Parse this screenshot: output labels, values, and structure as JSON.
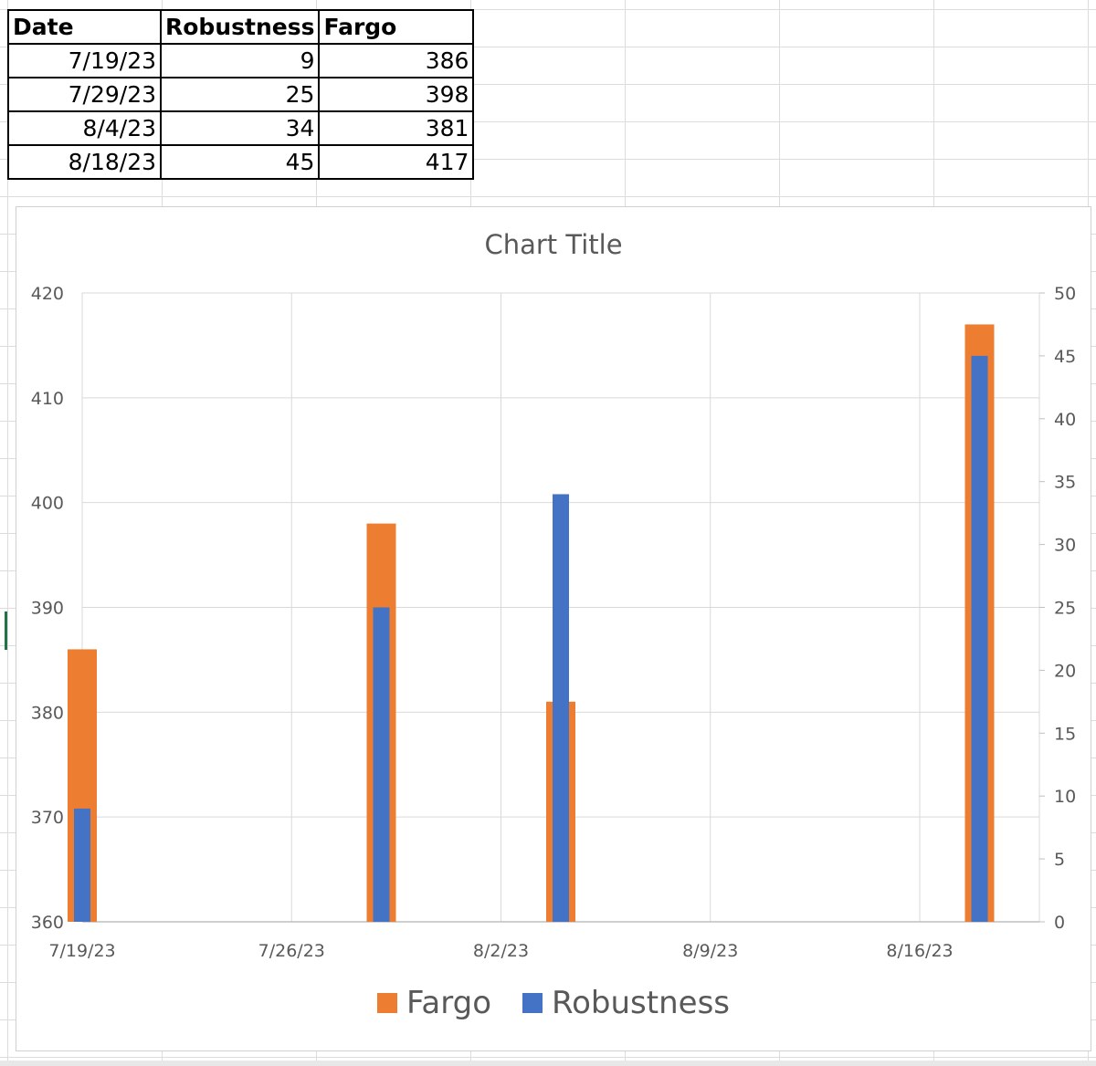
{
  "table": {
    "headers": [
      "Date",
      "Robustness",
      "Fargo"
    ],
    "rows": [
      [
        "7/19/23",
        "9",
        "386"
      ],
      [
        "7/29/23",
        "25",
        "398"
      ],
      [
        "8/4/23",
        "34",
        "381"
      ],
      [
        "8/18/23",
        "45",
        "417"
      ]
    ]
  },
  "chart_data": {
    "type": "bar",
    "title": "Chart Title",
    "x": [
      "7/19/23",
      "7/29/23",
      "8/4/23",
      "8/18/23"
    ],
    "x_axis": {
      "range": [
        "7/19/23",
        "8/20/23"
      ],
      "tick_labels": [
        "7/19/23",
        "7/26/23",
        "8/2/23",
        "8/9/23",
        "8/16/23"
      ]
    },
    "series": [
      {
        "name": "Fargo",
        "axis": "primary",
        "values": [
          386,
          398,
          381,
          417
        ],
        "color": "#ED7D31"
      },
      {
        "name": "Robustness",
        "axis": "secondary",
        "values": [
          9,
          25,
          34,
          45
        ],
        "color": "#4472C4"
      }
    ],
    "y_primary": {
      "ylim": [
        360,
        420
      ],
      "ticks": [
        360,
        370,
        380,
        390,
        400,
        410,
        420
      ]
    },
    "y_secondary": {
      "ylim": [
        0,
        50
      ],
      "ticks": [
        0,
        5,
        10,
        15,
        20,
        25,
        30,
        35,
        40,
        45,
        50
      ]
    },
    "grid": true,
    "legend_position": "bottom"
  }
}
